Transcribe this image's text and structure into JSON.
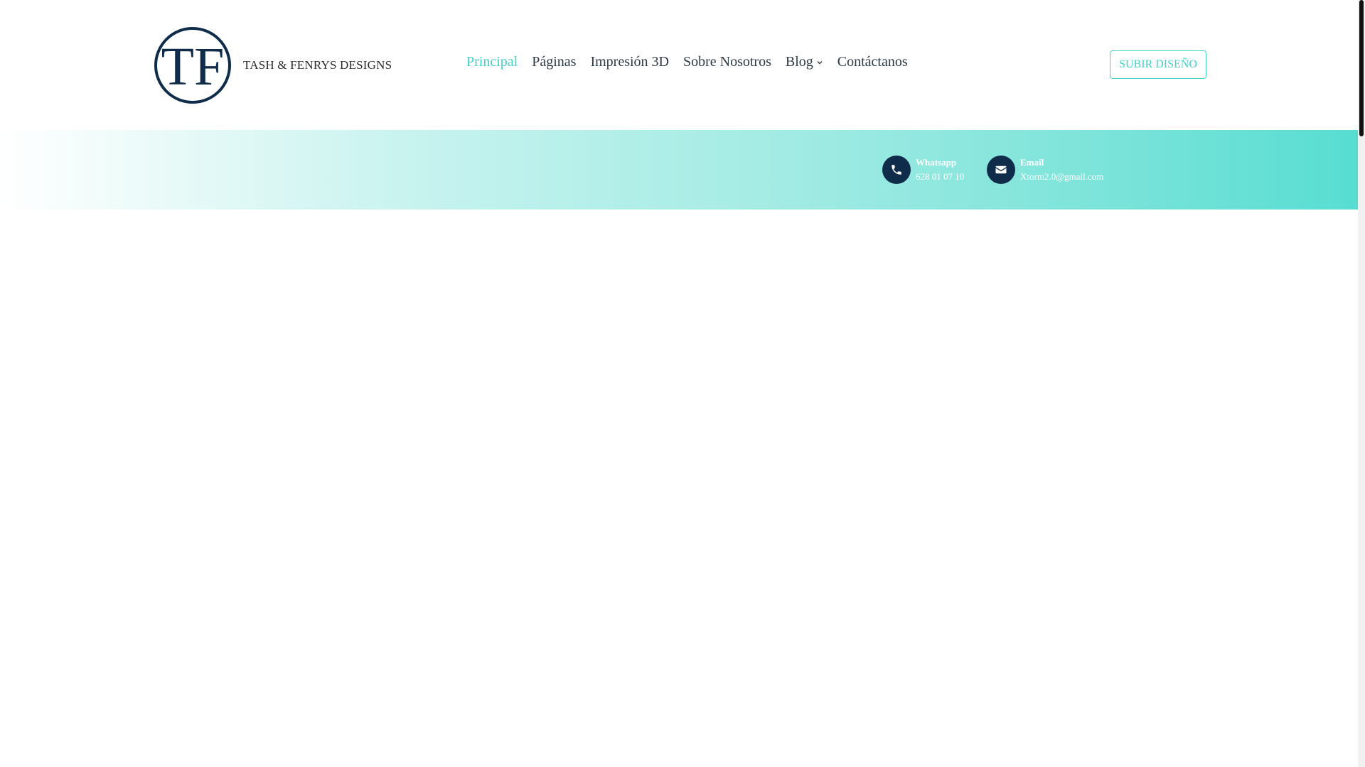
{
  "brand": {
    "logo_letters": "TF",
    "name": "TASH & FENRYS DESIGNS"
  },
  "nav": {
    "items": [
      {
        "label": "Principal",
        "active": true
      },
      {
        "label": "Páginas"
      },
      {
        "label": "Impresión 3D"
      },
      {
        "label": "Sobre Nosotros"
      },
      {
        "label": "Blog",
        "has_dropdown": true
      },
      {
        "label": "Contáctanos"
      }
    ]
  },
  "cta": {
    "label": "SUBIR DISEÑO"
  },
  "contact": {
    "whatsapp": {
      "icon": "phone-icon",
      "title": "Whatsapp",
      "value": "628 01 07 10"
    },
    "email": {
      "icon": "envelope-icon",
      "title": "Email",
      "value": "Xtorm2.0@gmail.com"
    }
  },
  "colors": {
    "accent": "#3fd3c7",
    "navy": "#0f2d4a",
    "text": "#2d3a44"
  }
}
